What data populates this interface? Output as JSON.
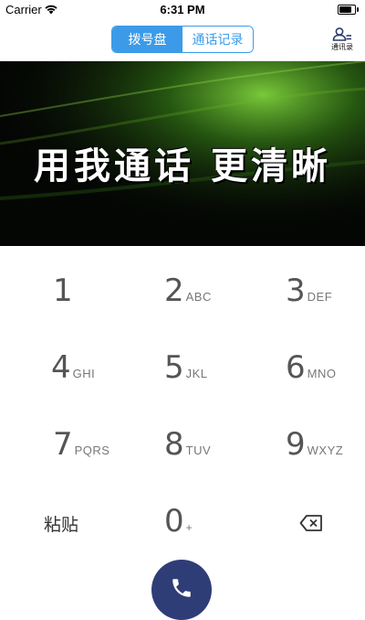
{
  "status_bar": {
    "carrier": "Carrier",
    "time": "6:31 PM",
    "battery_level": 0.85
  },
  "nav": {
    "tabs": [
      {
        "label": "拨号盘",
        "active": true
      },
      {
        "label": "通话记录",
        "active": false
      }
    ],
    "contacts_label": "通讯录",
    "contacts_icon": "contacts-icon",
    "accent_color": "#3c9be8"
  },
  "banner": {
    "slogan": "用我通话 更清晰"
  },
  "keypad": {
    "keys": [
      {
        "digit": "1",
        "letters": ""
      },
      {
        "digit": "2",
        "letters": "ABC"
      },
      {
        "digit": "3",
        "letters": "DEF"
      },
      {
        "digit": "4",
        "letters": "GHI"
      },
      {
        "digit": "5",
        "letters": "JKL"
      },
      {
        "digit": "6",
        "letters": "MNO"
      },
      {
        "digit": "7",
        "letters": "PQRS"
      },
      {
        "digit": "8",
        "letters": "TUV"
      },
      {
        "digit": "9",
        "letters": "WXYZ"
      },
      {
        "digit": "0",
        "letters": "+"
      }
    ],
    "paste_label": "粘贴",
    "backspace_icon": "backspace-icon"
  },
  "call": {
    "icon": "phone-icon",
    "color": "#2f3d77"
  }
}
